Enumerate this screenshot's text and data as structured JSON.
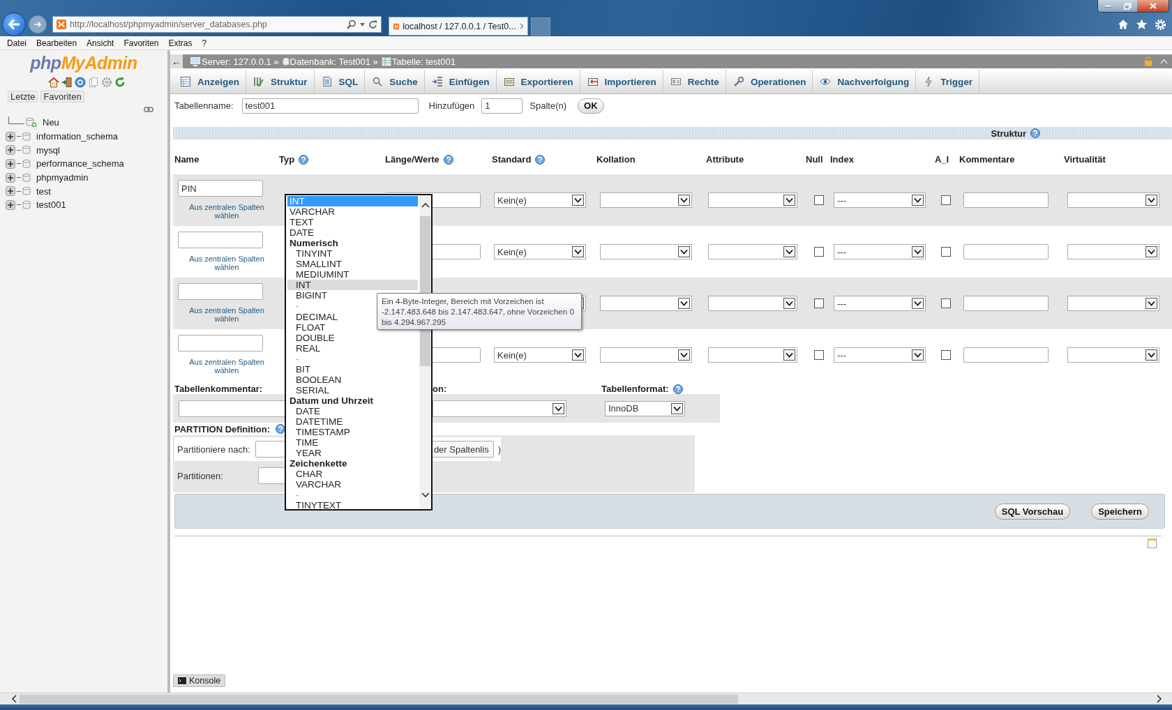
{
  "browser": {
    "address": "http://localhost/phpmyadmin/server_databases.php",
    "tab_title": "localhost / 127.0.0.1 / Test0..."
  },
  "menu": [
    "Datei",
    "Bearbeiten",
    "Ansicht",
    "Favoriten",
    "Extras",
    "?"
  ],
  "sidebar": {
    "logo_first": "php",
    "logo_second": "MyAdmin",
    "buttons": [
      "Letzte",
      "Favoriten"
    ],
    "tree": [
      {
        "label": "Neu",
        "kind": "new"
      },
      {
        "label": "information_schema",
        "kind": "database",
        "expanded": false
      },
      {
        "label": "mysql",
        "kind": "database",
        "expanded": false
      },
      {
        "label": "performance_schema",
        "kind": "database",
        "expanded": false
      },
      {
        "label": "phpmyadmin",
        "kind": "database",
        "expanded": false
      },
      {
        "label": "test",
        "kind": "database",
        "expanded": false
      },
      {
        "label": "test001",
        "kind": "database",
        "expanded": false
      }
    ]
  },
  "breadcrumb": {
    "back": "←",
    "items": [
      {
        "label": "Server: 127.0.0.1 »",
        "kind": "server"
      },
      {
        "label": "Datenbank: Test001 »",
        "kind": "database"
      },
      {
        "label": "Tabelle: test001",
        "kind": "table"
      }
    ]
  },
  "tabs": [
    "Anzeigen",
    "Struktur",
    "SQL",
    "Suche",
    "Einfügen",
    "Exportieren",
    "Importieren",
    "Rechte",
    "Operationen",
    "Nachverfolgung",
    "Trigger"
  ],
  "table_form": {
    "name_label": "Tabellenname:",
    "name_value": "test001",
    "add_label": "Hinzufügen",
    "add_value": "1",
    "add_unit": "Spalte(n)",
    "ok_button": "OK"
  },
  "structure": {
    "title": "Struktur",
    "columns": [
      {
        "label": "Name",
        "help": false
      },
      {
        "label": "Typ",
        "help": true
      },
      {
        "label": "Länge/Werte",
        "help": true
      },
      {
        "label": "Standard",
        "help": true
      },
      {
        "label": "Kollation",
        "help": false
      },
      {
        "label": "Attribute",
        "help": false
      },
      {
        "label": "Null",
        "help": false
      },
      {
        "label": "Index",
        "help": false
      },
      {
        "label": "A_I",
        "help": false
      },
      {
        "label": "Kommentare",
        "help": false
      },
      {
        "label": "Virtualität",
        "help": false
      }
    ],
    "rows": [
      {
        "name": "PIN",
        "central_link": "Aus zentralen Spalten wählen",
        "standard": "Kein(e)",
        "null": false,
        "index": "---",
        "ai": false
      },
      {
        "central_link": "Aus zentralen Spalten wählen",
        "standard": "Kein(e)",
        "null": false,
        "index": "---",
        "ai": false
      },
      {
        "central_link": "Aus zentralen Spalten wählen",
        "null": false,
        "index": "---",
        "ai": false
      },
      {
        "central_link": "Aus zentralen Spalten wählen",
        "standard": "Kein(e)",
        "null": false,
        "index": "---",
        "ai": false
      }
    ]
  },
  "type_dropdown": {
    "items": [
      {
        "kind": "option",
        "label": "INT",
        "selected": true,
        "hovered": false
      },
      {
        "kind": "option",
        "label": "VARCHAR",
        "selected": false,
        "hovered": false
      },
      {
        "kind": "option",
        "label": "TEXT",
        "selected": false,
        "hovered": false
      },
      {
        "kind": "option",
        "label": "DATE",
        "selected": false,
        "hovered": false
      },
      {
        "kind": "group",
        "label": "Numerisch",
        "children": [
          {
            "kind": "option",
            "label": "TINYINT",
            "selected": false,
            "hovered": false
          },
          {
            "kind": "option",
            "label": "SMALLINT",
            "selected": false,
            "hovered": false
          },
          {
            "kind": "option",
            "label": "MEDIUMINT",
            "selected": false,
            "hovered": false
          },
          {
            "kind": "option",
            "label": "INT",
            "selected": false,
            "hovered": true
          },
          {
            "kind": "option",
            "label": "BIGINT",
            "selected": false,
            "hovered": false
          },
          {
            "kind": "separator",
            "label": "-"
          },
          {
            "kind": "option",
            "label": "DECIMAL",
            "selected": false,
            "hovered": false
          },
          {
            "kind": "option",
            "label": "FLOAT",
            "selected": false,
            "hovered": false
          },
          {
            "kind": "option",
            "label": "DOUBLE",
            "selected": false,
            "hovered": false
          },
          {
            "kind": "option",
            "label": "REAL",
            "selected": false,
            "hovered": false
          },
          {
            "kind": "separator",
            "label": "-"
          },
          {
            "kind": "option",
            "label": "BIT",
            "selected": false,
            "hovered": false
          },
          {
            "kind": "option",
            "label": "BOOLEAN",
            "selected": false,
            "hovered": false
          },
          {
            "kind": "option",
            "label": "SERIAL",
            "selected": false,
            "hovered": false
          }
        ]
      },
      {
        "kind": "group",
        "label": "Datum und Uhrzeit",
        "children": [
          {
            "kind": "option",
            "label": "DATE",
            "selected": false,
            "hovered": false
          },
          {
            "kind": "option",
            "label": "DATETIME",
            "selected": false,
            "hovered": false
          },
          {
            "kind": "option",
            "label": "TIMESTAMP",
            "selected": false,
            "hovered": false
          },
          {
            "kind": "option",
            "label": "TIME",
            "selected": false,
            "hovered": false
          },
          {
            "kind": "option",
            "label": "YEAR",
            "selected": false,
            "hovered": false
          }
        ]
      },
      {
        "kind": "group",
        "label": "Zeichenkette",
        "children": [
          {
            "kind": "option",
            "label": "CHAR",
            "selected": false,
            "hovered": false
          },
          {
            "kind": "option",
            "label": "VARCHAR",
            "selected": false,
            "hovered": false
          },
          {
            "kind": "separator",
            "label": "-"
          },
          {
            "kind": "option",
            "label": "TINYTEXT",
            "selected": false,
            "hovered": false
          }
        ]
      }
    ]
  },
  "tooltip": "Ein 4-Byte-Integer, Bereich mit Vorzeichen ist -2.147.483.648 bis 2.147.483.647, ohne Vorzeichen 0 bis 4.294.967.295",
  "table_options": {
    "comment_label": "Tabellenkommentar:",
    "collation_label_fragment": "on:",
    "format_label": "Tabellenformat:",
    "format_value": "InnoDB"
  },
  "partition": {
    "title": "PARTITION Definition:",
    "by_label": "Partitioniere nach:",
    "column_list_button": "der Spaltenlis",
    "closing_paren": ")",
    "count_label": "Partitionen:"
  },
  "actions": [
    "SQL Vorschau",
    "Speichern"
  ],
  "console": "Konsole"
}
